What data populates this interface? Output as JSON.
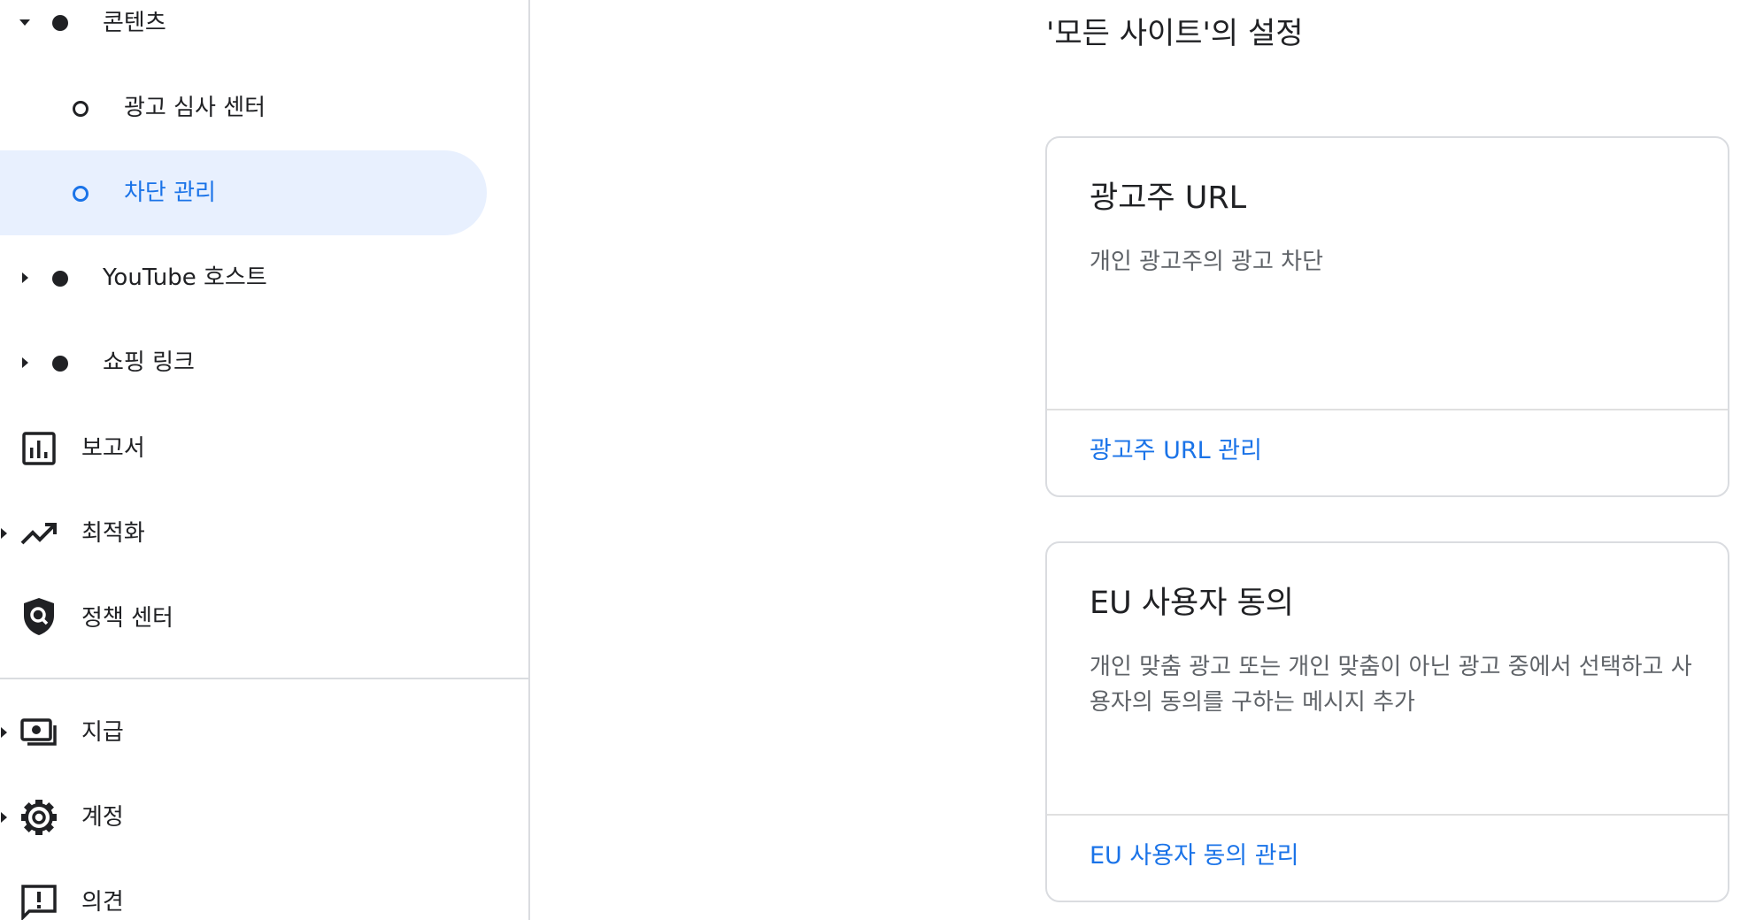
{
  "sidebar": {
    "content": {
      "label": "콘텐츠"
    },
    "ad_review": {
      "label": "광고 심사 센터"
    },
    "blocking": {
      "label": "차단 관리"
    },
    "youtube_host": {
      "label": "YouTube 호스트"
    },
    "shopping_link": {
      "label": "쇼핑 링크"
    },
    "reports": {
      "label": "보고서",
      "icon": "bar-chart-icon"
    },
    "optimization": {
      "label": "최적화",
      "icon": "trending-up-icon"
    },
    "policy_center": {
      "label": "정책 센터",
      "icon": "shield-search-icon"
    },
    "payments": {
      "label": "지급",
      "icon": "payments-icon"
    },
    "account": {
      "label": "계정",
      "icon": "gear-icon"
    },
    "feedback": {
      "label": "의견",
      "icon": "feedback-icon"
    }
  },
  "main": {
    "heading": "'모든 사이트'의 설정",
    "cards": [
      {
        "title": "광고주 URL",
        "description": "개인 광고주의 광고 차단",
        "link": "광고주 URL 관리"
      },
      {
        "title": "EU 사용자 동의",
        "description": "개인 맞춤 광고 또는 개인 맞춤이 아닌 광고 중에서 선택하고 사용자의 동의를 구하는 메시지 추가",
        "link": "EU 사용자 동의 관리"
      }
    ]
  },
  "colors": {
    "accent": "#1a73e8",
    "active_bg": "#e8f0fe",
    "text": "#202124",
    "secondary_text": "#5f6368",
    "divider": "#dadce0"
  }
}
